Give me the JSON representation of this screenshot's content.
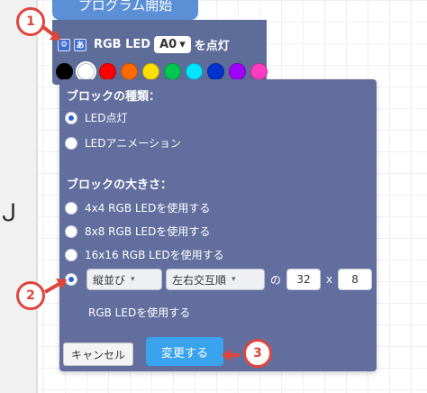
{
  "hat_block": {
    "label": "プログラム開始"
  },
  "led_block": {
    "icon1": "⚙",
    "icon2": "あ",
    "label": "RGB LED",
    "port": "A0",
    "suffix": "を点灯",
    "palette": [
      "#000000",
      "#ffffff",
      "#ff0000",
      "#ff6a00",
      "#ffe000",
      "#00c853",
      "#00e5ff",
      "#0033cc",
      "#a000ff",
      "#ff3cc0"
    ]
  },
  "dialog": {
    "type_title": "ブロックの種類：",
    "type_options": [
      {
        "label": "LED点灯",
        "selected": true
      },
      {
        "label": "LEDアニメーション",
        "selected": false
      }
    ],
    "size_title": "ブロックの大きさ：",
    "size_options": [
      {
        "label": "4x4 RGB LEDを使用する",
        "selected": false
      },
      {
        "label": "8x8 RGB LEDを使用する",
        "selected": false
      },
      {
        "label": "16x16 RGB LEDを使用する",
        "selected": false
      }
    ],
    "custom": {
      "selected": true,
      "orientation": "縦並び",
      "order": "左右交互順",
      "connector": "の",
      "width": "32",
      "x_sep": "x",
      "height": "8",
      "suffix": "RGB LEDを使用する"
    },
    "cancel_label": "キャンセル",
    "change_label": "変更する"
  },
  "callouts": [
    "1",
    "2",
    "3"
  ],
  "left_panel_glyph": "ᒍ"
}
